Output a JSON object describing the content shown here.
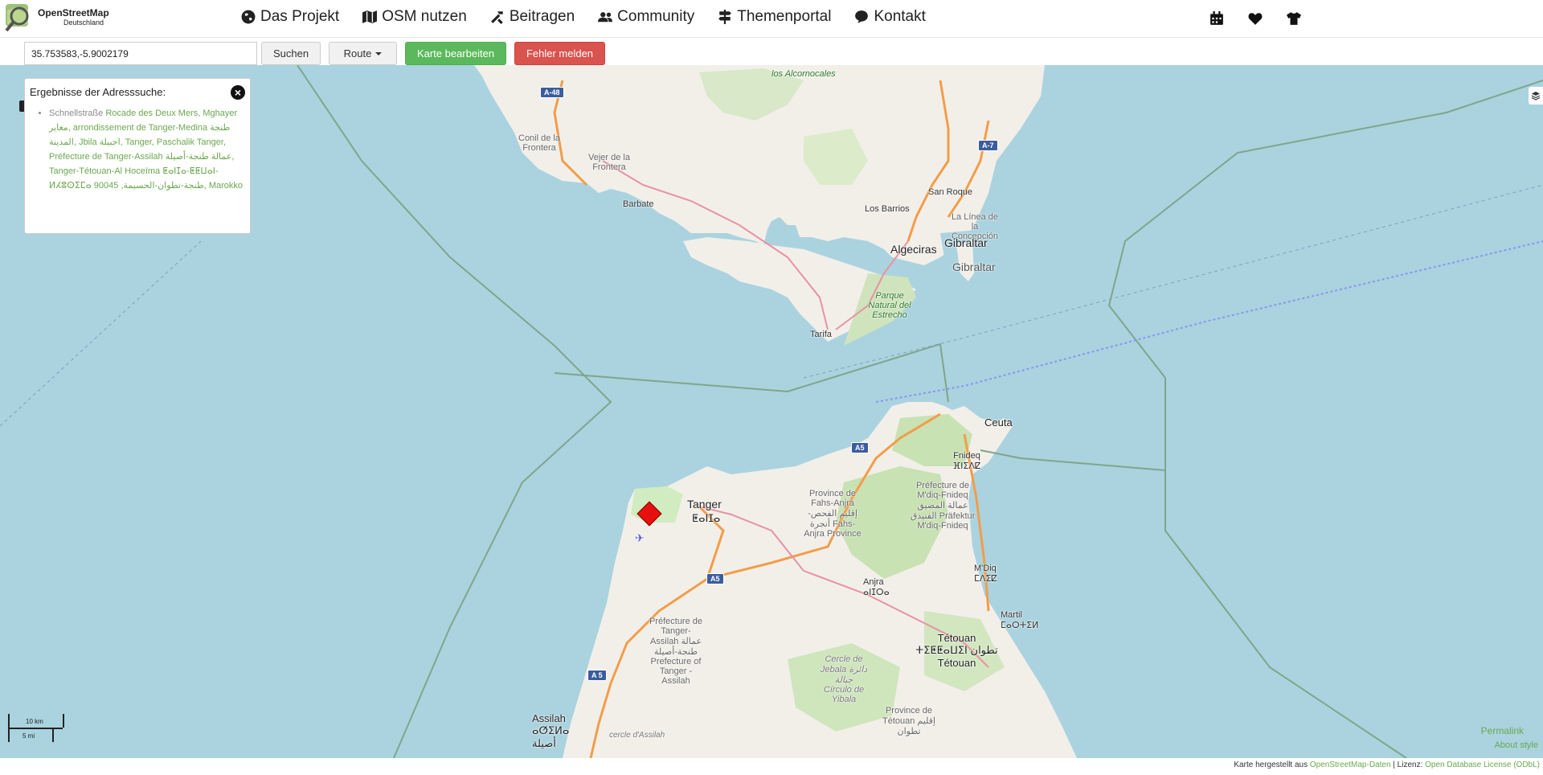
{
  "header": {
    "logo_title": "OpenStreetMap",
    "logo_subtitle": "Deutschland",
    "nav": [
      {
        "label": "Das Projekt",
        "icon": "globe-icon"
      },
      {
        "label": "OSM nutzen",
        "icon": "map-icon"
      },
      {
        "label": "Beitragen",
        "icon": "tools-icon"
      },
      {
        "label": "Community",
        "icon": "users-icon"
      },
      {
        "label": "Themenportal",
        "icon": "signpost-icon"
      },
      {
        "label": "Kontakt",
        "icon": "chat-icon"
      }
    ],
    "right_icons": [
      "calendar-icon",
      "heart-icon",
      "tshirt-icon"
    ]
  },
  "search": {
    "value": "35.753583,-5.9002179",
    "search_label": "Suchen",
    "route_label": "Route",
    "edit_label": "Karte bearbeiten",
    "report_label": "Fehler melden"
  },
  "results": {
    "title": "Ergebnisse der Adresssuche:",
    "prefix": "Schnellstraße ",
    "address": "Rocade des Deux Mers, Mghayer مغاير, arrondissement de Tanger-Medina طنجة المدينة, Jbila اجبيلة, Tanger, Paschalik Tanger, Préfecture de Tanger-Assilah عمالة طنجة-أصيلة, Tanger-Tétouan-Al Hoceïma ⵟⴰⵏⵊⴰ-ⵟⵟⵡⴰⵏ-ⵍⵃⵓⵙⵉⵎⴰ طنجة-تطوان-الحسيمة, 90045, Marokko"
  },
  "map": {
    "labels": {
      "alcornocales": "los Alcornocales",
      "conil": "Conil de la Frontera",
      "vejer": "Vejer de la Frontera",
      "barbate": "Barbate",
      "los_barrios": "Los Barrios",
      "san_roque": "San Roque",
      "la_linea": "La Línea de la Concepción",
      "algeciras": "Algeciras",
      "gibraltar1": "Gibraltar",
      "gibraltar2": "Gibraltar",
      "parque": "Parque Natural del Estrecho",
      "tarifa": "Tarifa",
      "ceuta": "Ceuta",
      "fnideq": "Fnideq ⴼⵏⵉⴷⵇ",
      "tanger": "Tanger",
      "tanger_tif": "ⵟⴰⵏⵊⴰ",
      "province_fahs": "Province de Fahs-Anjra إقليم الفحص-أنجرة Fahs-Anjra Province",
      "prefecture_mdiq": "Préfecture de M'diq-Fnideq عمالة المضيق الفنيدق Präfektur M'diq-Fnideq",
      "mdiq": "M'Diq ⵎⴷⵉⵇ",
      "anjra": "Anjra ⴰⵏⵊⵔⴰ",
      "martil": "Martil ⵎⴰⵔⵜⵉⵍ",
      "prefecture_tanger": "Préfecture de Tanger-Assilah عمالة طنجة-أصيلة Prefecture of Tanger - Assilah",
      "tetouan": "Tétouan ⵜⵉⵟⵟⴰⵡⵉⵏ تطوان Tétouan",
      "cercle_jebala": "Cercle de Jebala دائرة جبالة Círculo de Yibala",
      "province_tetouan": "Province de Tétouan إقليم تطوان",
      "assilah": "Assilah ⴰⵚⵉⵍⴰ أصيلة",
      "cercle_assilah": "cercle d'Assilah"
    },
    "shields": [
      "A-48",
      "A-7",
      "A5",
      "A5",
      "A 5"
    ],
    "scale_km": "10 km",
    "scale_mi": "5 mi",
    "permalink": "Permalink",
    "about_style": "About style"
  },
  "footer": {
    "text1": "Karte hergestellt aus ",
    "link1": "OpenStreetMap-Daten",
    "text2": " | Lizenz: ",
    "link2": "Open Database License (ODbL)"
  },
  "colors": {
    "sea": "#aad3df",
    "land": "#f2efe9",
    "forest": "#c8e2b3",
    "edit_button": "#5cb85c",
    "report_button": "#d9534f",
    "link": "#6aa84f"
  }
}
